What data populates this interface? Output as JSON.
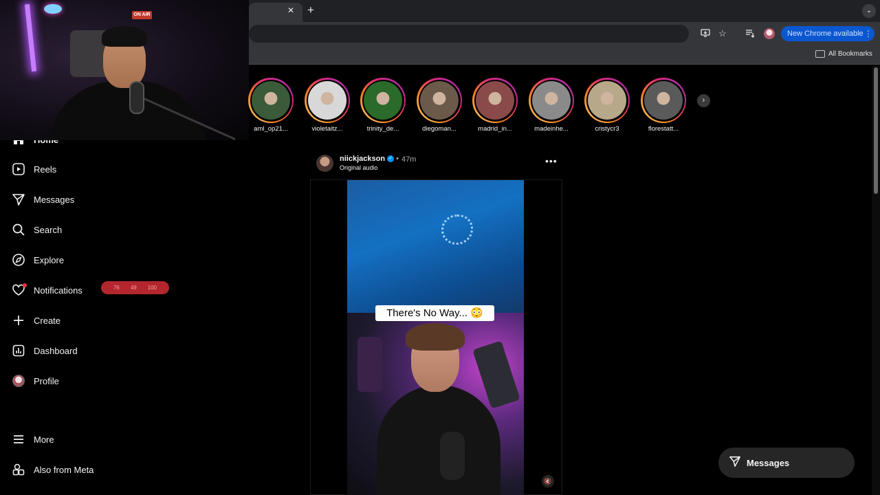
{
  "browser": {
    "update_button": "New Chrome available",
    "bookmarks_label": "All Bookmarks",
    "tab_close": "✕",
    "new_tab": "+"
  },
  "webcam": {
    "on_air": "ON AIR"
  },
  "sidebar": {
    "items": [
      {
        "label": "Home",
        "icon": "home-icon"
      },
      {
        "label": "Reels",
        "icon": "reels-icon"
      },
      {
        "label": "Messages",
        "icon": "messages-icon"
      },
      {
        "label": "Search",
        "icon": "search-icon"
      },
      {
        "label": "Explore",
        "icon": "explore-icon"
      },
      {
        "label": "Notifications",
        "icon": "heart-icon"
      },
      {
        "label": "Create",
        "icon": "plus-icon"
      },
      {
        "label": "Dashboard",
        "icon": "dashboard-icon"
      },
      {
        "label": "Profile",
        "icon": "avatar"
      },
      {
        "label": "More",
        "icon": "menu-icon"
      },
      {
        "label": "Also from Meta",
        "icon": "meta-apps-icon"
      }
    ],
    "notification_badge": [
      "76",
      "49",
      "100"
    ]
  },
  "stories": [
    {
      "name": "aml_op21...",
      "color": "#3a5a3a"
    },
    {
      "name": "violetaitz...",
      "color": "#d8d8d8"
    },
    {
      "name": "trinity_de...",
      "color": "#2a6a2a"
    },
    {
      "name": "diegoman...",
      "color": "#6b5a4a"
    },
    {
      "name": "madrid_in...",
      "color": "#8a4a4a"
    },
    {
      "name": "madeinhe...",
      "color": "#8a8a8a"
    },
    {
      "name": "cristycr3",
      "color": "#b8a88a"
    },
    {
      "name": "florestatt...",
      "color": "#5a5a5a"
    }
  ],
  "post": {
    "username": "niickjackson",
    "separator": "•",
    "time": "47m",
    "audio": "Original audio",
    "caption": "There's No Way... 😳",
    "more": "•••"
  },
  "floating_messages": {
    "label": "Messages"
  }
}
